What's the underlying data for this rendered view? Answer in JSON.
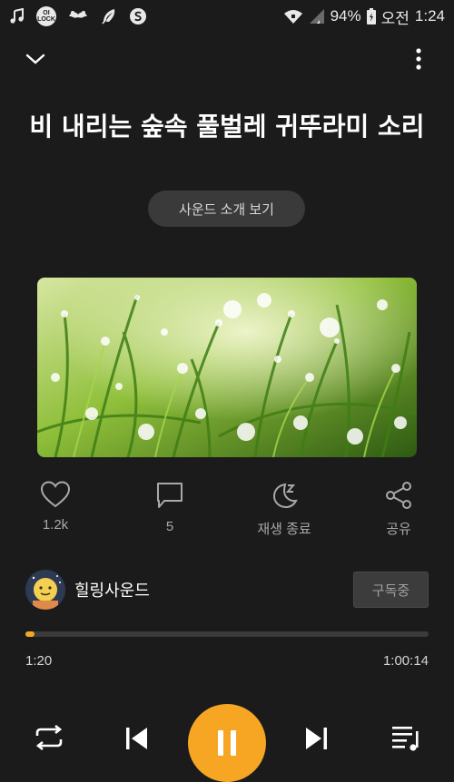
{
  "status_bar": {
    "battery": "94%",
    "ampm": "오전",
    "time": "1:24",
    "app_icons": [
      "music-note-icon",
      "ok-lock-icon",
      "mustache-icon",
      "feather-icon",
      "s-circle-icon"
    ],
    "ok_lock_label": "OI\nLOCK"
  },
  "player": {
    "title": "비 내리는 숲속 풀벌레 귀뚜라미 소리",
    "intro_button": "사운드 소개 보기",
    "actions": {
      "like_count": "1.2k",
      "comment_count": "5",
      "sleep_label": "재생 종료",
      "share_label": "공유"
    },
    "channel": {
      "name": "힐링사운드",
      "subscribe_label": "구독중"
    },
    "progress": {
      "current": "1:20",
      "total": "1:00:14",
      "fraction": 0.022
    }
  },
  "colors": {
    "accent": "#f6a623",
    "background": "#1b1b1b"
  }
}
